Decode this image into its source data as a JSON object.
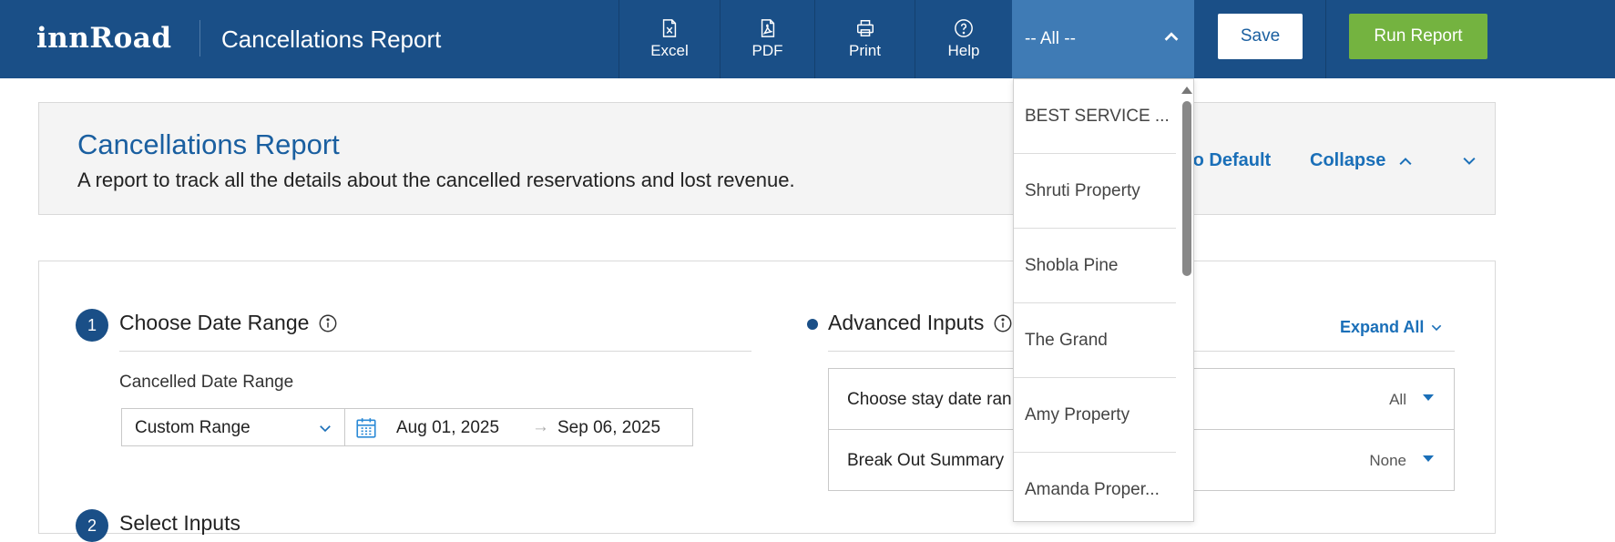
{
  "topbar": {
    "logo": "innRoad",
    "title": "Cancellations Report",
    "tools": {
      "excel": "Excel",
      "pdf": "PDF",
      "print": "Print",
      "help": "Help"
    },
    "property_select": "-- All --",
    "save_label": "Save",
    "run_label": "Run Report"
  },
  "header": {
    "title": "Cancellations Report",
    "description": "A report to track all the details about the cancelled reservations and lost revenue.",
    "reset_link": "to Default",
    "collapse_link": "Collapse"
  },
  "section1": {
    "number": "1",
    "title": "Choose Date Range",
    "field_label": "Cancelled Date Range",
    "range_value": "Custom Range",
    "date_start": "Aug 01, 2025",
    "date_arrow": "→",
    "date_end": "Sep 06, 2025"
  },
  "section2": {
    "number": "2",
    "title": "Select Inputs"
  },
  "advanced": {
    "title": "Advanced Inputs",
    "expand_all": "Expand All",
    "rows": [
      {
        "label": "Choose stay date ran",
        "value": "All"
      },
      {
        "label": "Break Out Summary",
        "value": "None"
      }
    ]
  },
  "dropdown": {
    "items": [
      "BEST SERVICE ...",
      "Shruti Property",
      "Shobla Pine",
      "The Grand",
      "Amy Property",
      "Amanda Proper..."
    ]
  }
}
